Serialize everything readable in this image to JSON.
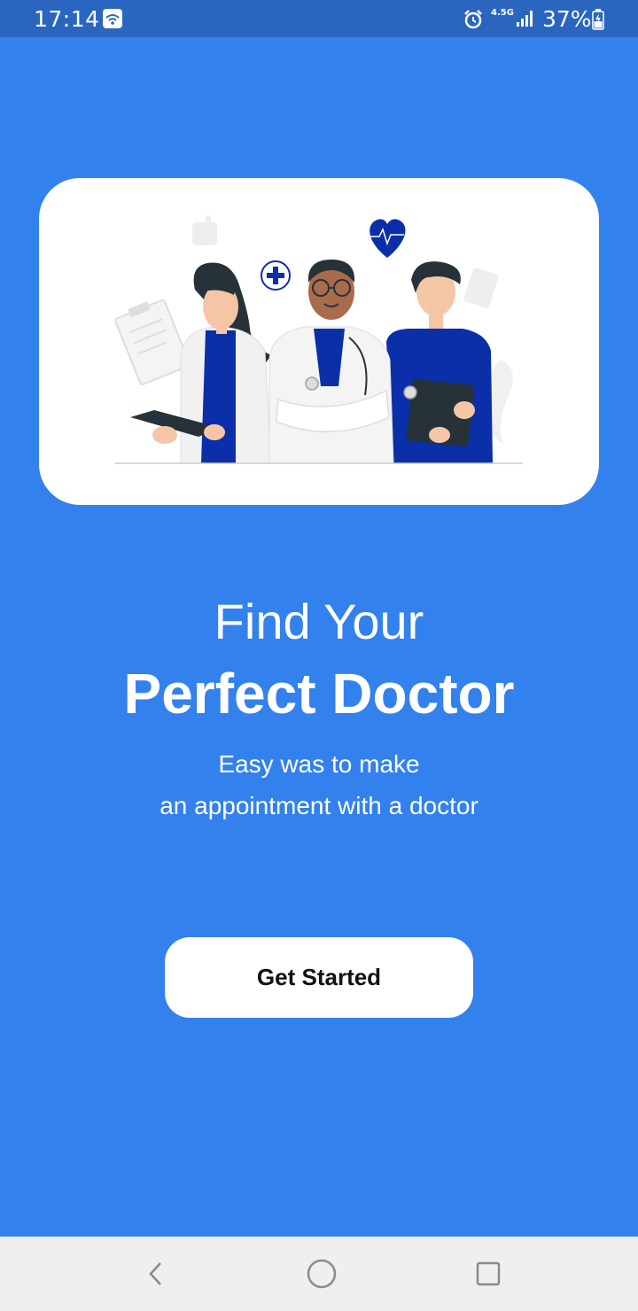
{
  "status_bar": {
    "time": "17:14",
    "network_type": "4.5G",
    "battery": "37%",
    "icons": [
      "wifi-icon",
      "alarm-icon",
      "signal-icon",
      "battery-charging-icon"
    ]
  },
  "hero": {
    "illustration": "three-doctors-illustration"
  },
  "headline": {
    "line1": "Find Your",
    "line2": "Perfect Doctor"
  },
  "subtitle": {
    "line1": "Easy was to make",
    "line2": "an appointment with a doctor"
  },
  "cta": {
    "label": "Get Started"
  },
  "nav_bar": {
    "icons": [
      "back-icon",
      "home-icon",
      "recents-icon"
    ]
  },
  "colors": {
    "background": "#3381EC",
    "status_bar": "#2A66BF",
    "card": "#FFFFFF",
    "accent_dark_blue": "#0A2FA8"
  }
}
